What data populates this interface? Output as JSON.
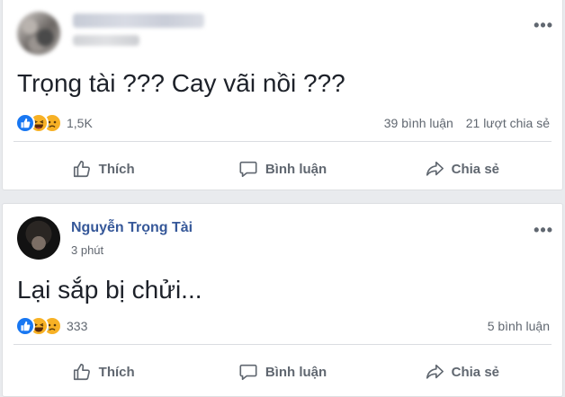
{
  "posts": [
    {
      "author": "",
      "time": "",
      "text": "Trọng tài ??? Cay vãi nồi ???",
      "reaction_count": "1,5K",
      "comments": "39 bình luận",
      "shares": "21 lượt chia sẻ",
      "blurred_header": true
    },
    {
      "author": "Nguyễn Trọng Tài",
      "time": "3 phút",
      "text": "Lại sắp bị chửi...",
      "reaction_count": "333",
      "comments": "5 bình luận",
      "shares": "",
      "blurred_header": false
    }
  ],
  "actions": {
    "like": "Thích",
    "comment": "Bình luận",
    "share": "Chia sẻ"
  },
  "menu_glyph": "•••",
  "icons": [
    "like-reaction-icon",
    "haha-reaction-icon",
    "sad-reaction-icon",
    "thumbs-up-icon",
    "comment-icon",
    "share-icon",
    "more-options-icon"
  ],
  "colors": {
    "author_link": "#365899",
    "like_blue": "#1877f2",
    "emoji_yellow": "#f7b125",
    "secondary_text": "#606770"
  }
}
